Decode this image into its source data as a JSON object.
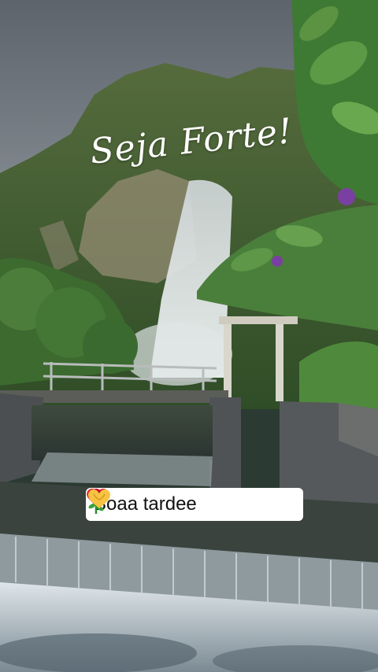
{
  "overlay": {
    "title": "Seja Forte!",
    "caption": {
      "text": "Boaa tardee",
      "emojis": [
        "heart-icon",
        "rose-icon",
        "heart-hands-icon"
      ]
    }
  },
  "colors": {
    "sky": "#6f7680",
    "foliage": "#3f6a35",
    "waterfall": "#e6ecef",
    "stone": "#4b4f52",
    "flower": "#7a3fa3",
    "heart": "#e0202a"
  }
}
